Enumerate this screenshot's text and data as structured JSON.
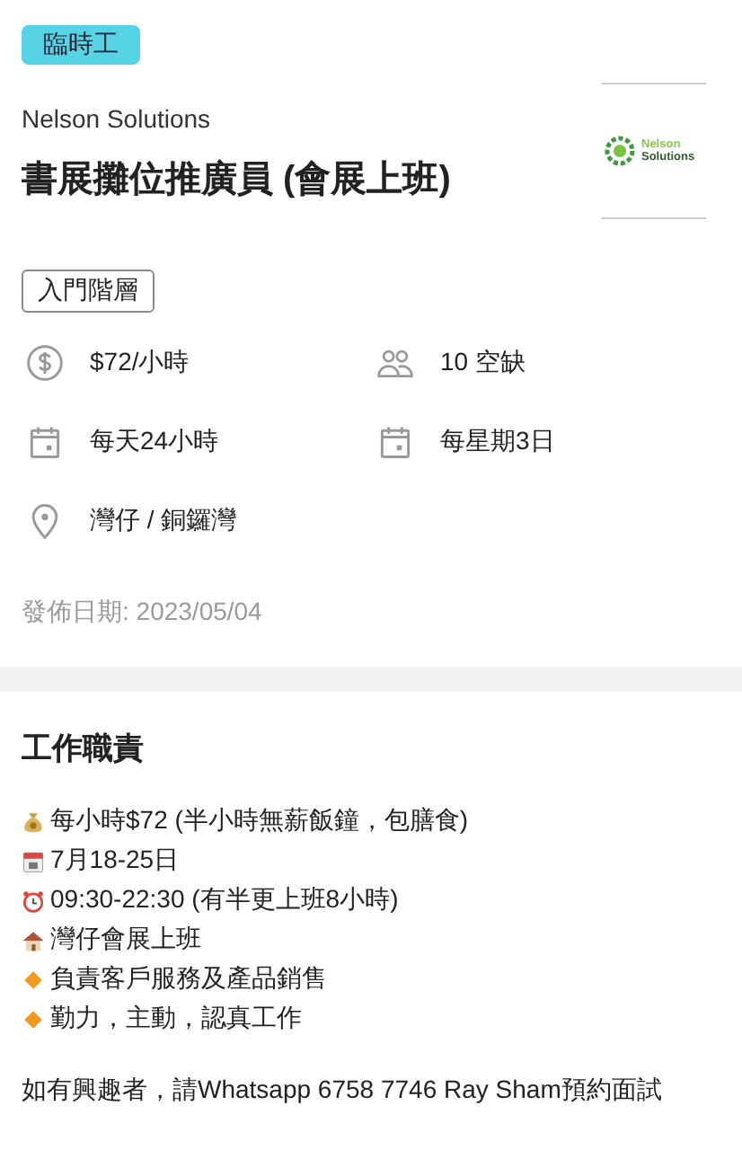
{
  "job": {
    "type_badge": "臨時工",
    "company": "Nelson Solutions",
    "title": "書展攤位推廣員 (會展上班)",
    "logo": {
      "line1": "Nelson",
      "line2": "Solutions"
    },
    "level_badge": "入門階層",
    "facts": [
      {
        "kind": "salary",
        "text": "$72/小時"
      },
      {
        "kind": "people",
        "text": "10 空缺"
      },
      {
        "kind": "calendar",
        "text": "每天24小時"
      },
      {
        "kind": "calendar",
        "text": "每星期3日"
      },
      {
        "kind": "location",
        "text": "灣仔 / 銅鑼灣"
      }
    ],
    "posted": "發佈日期: 2023/05/04"
  },
  "duties": {
    "heading": "工作職責",
    "items": [
      {
        "kind": "money",
        "text": "每小時$72 (半小時無薪飯鐘，包膳食)"
      },
      {
        "kind": "calendar",
        "text": "7月18-25日"
      },
      {
        "kind": "clock",
        "text": "09:30-22:30 (有半更上班8小時)"
      },
      {
        "kind": "house",
        "text": "灣仔會展上班"
      },
      {
        "kind": "diamond",
        "text": "負責客戶服務及產品銷售"
      },
      {
        "kind": "diamond",
        "text": "勤力，主動，認真工作"
      }
    ],
    "contact": "如有興趣者，請Whatsapp 6758 7746 Ray Sham預約面試"
  }
}
